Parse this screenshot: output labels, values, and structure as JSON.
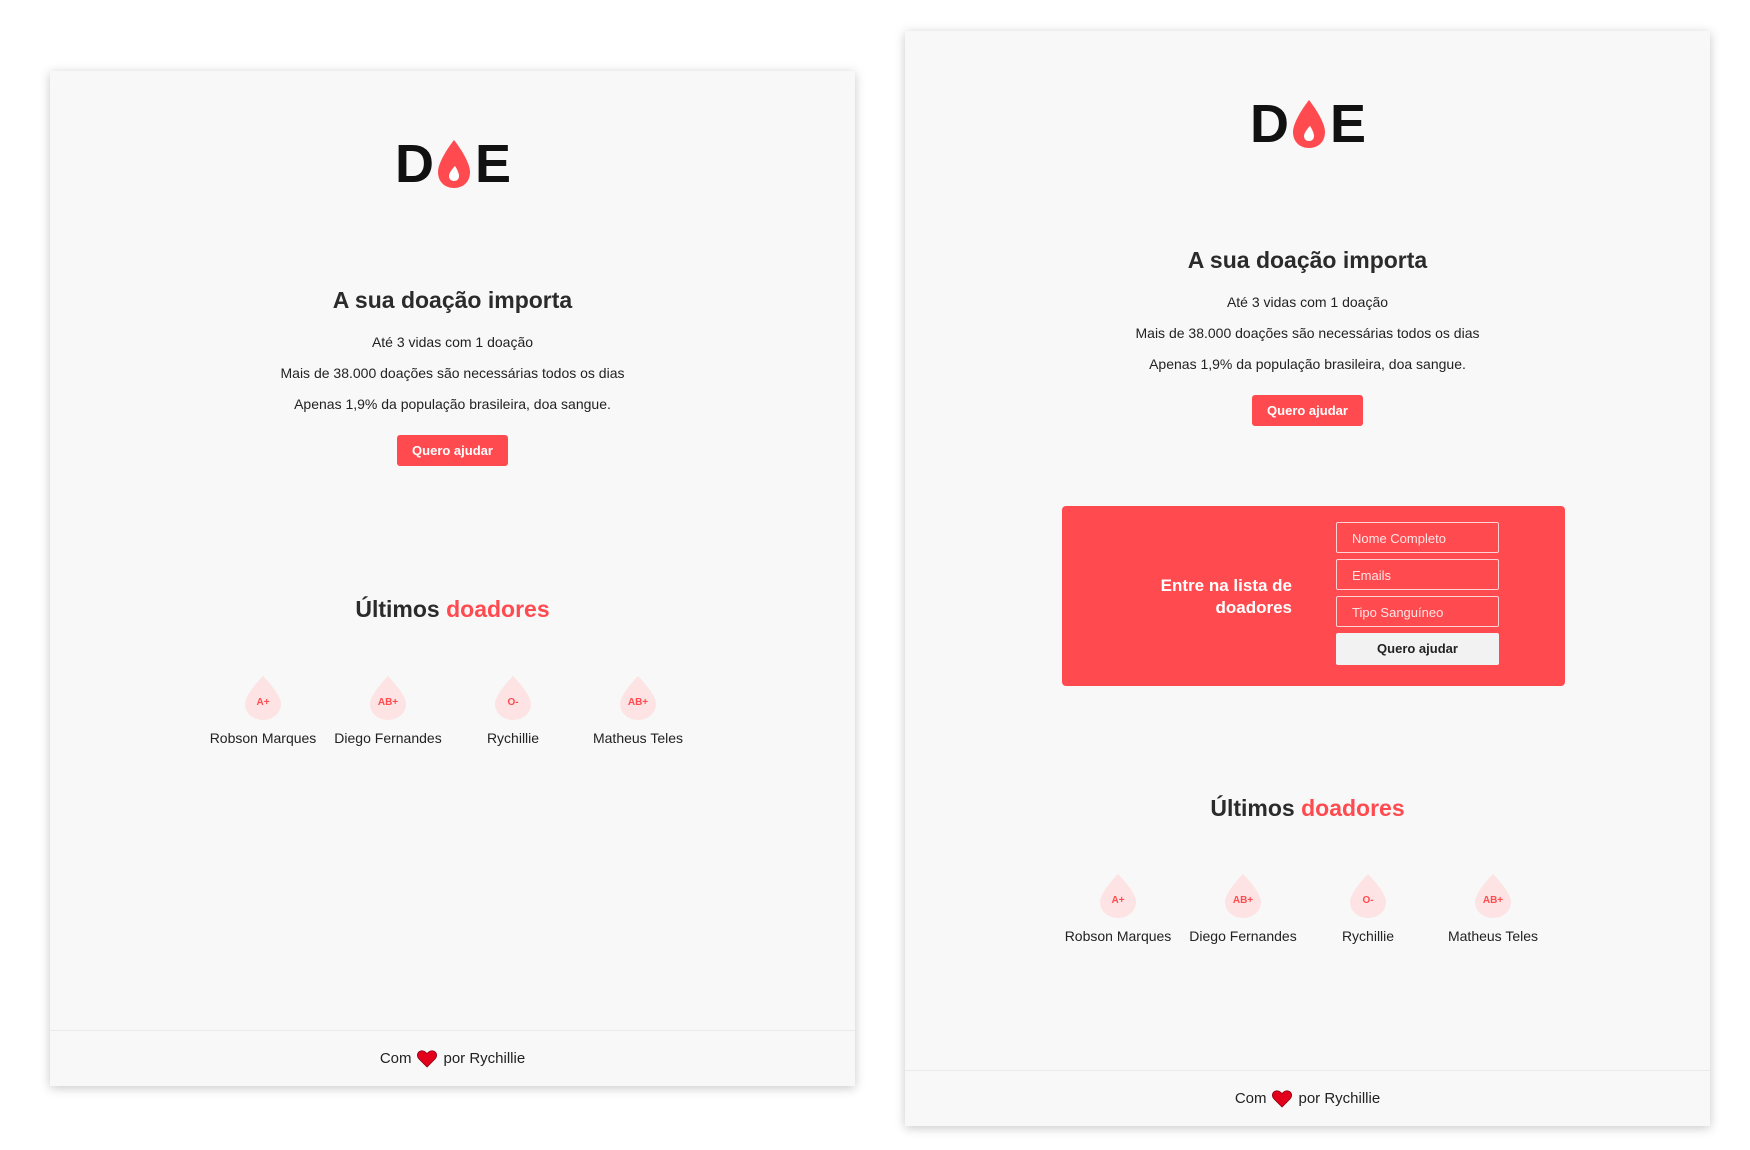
{
  "brand": {
    "logo_left": "D",
    "logo_right": "E",
    "accent_color": "#ff4b4f",
    "drop_icon": "blood-drop-icon"
  },
  "hero": {
    "title": "A sua doação importa",
    "lines": [
      "Até 3 vidas com 1 doação",
      "Mais de 38.000 doações são necessárias todos os dias",
      "Apenas 1,9% da população brasileira, doa sangue."
    ],
    "cta_label": "Quero ajudar"
  },
  "form": {
    "title": "Entre na lista de doadores",
    "fields": [
      {
        "placeholder": "Nome Completo"
      },
      {
        "placeholder": "Emails"
      },
      {
        "placeholder": "Tipo Sanguíneo"
      }
    ],
    "submit_label": "Quero ajudar"
  },
  "donors_section": {
    "title_prefix": "Últimos",
    "title_accent": "doadores",
    "donors": [
      {
        "blood": "A+",
        "name": "Robson Marques"
      },
      {
        "blood": "AB+",
        "name": "Diego Fernandes"
      },
      {
        "blood": "O-",
        "name": "Rychillie"
      },
      {
        "blood": "AB+",
        "name": "Matheus Teles"
      }
    ]
  },
  "footer": {
    "prefix": "Com",
    "suffix": "por Rychillie",
    "heart_icon": "heart-icon"
  }
}
